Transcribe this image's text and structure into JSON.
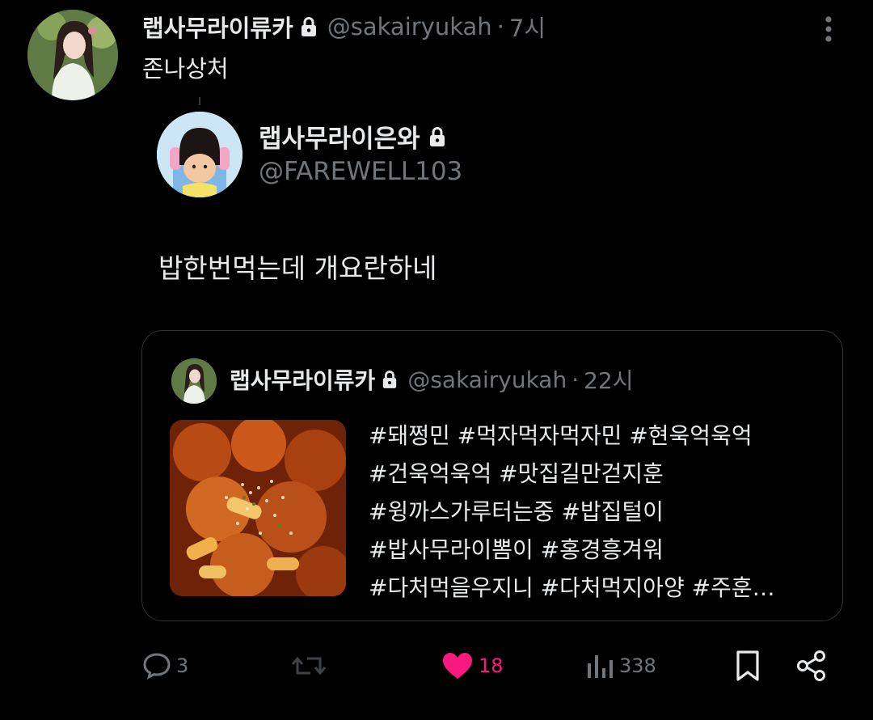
{
  "tweet": {
    "display_name": "랩사무라이류카",
    "handle": "@sakairyukah",
    "separator": "·",
    "time": "7시",
    "text": "존나상처"
  },
  "embedded": {
    "display_name": "랩사무라이은와",
    "handle": "@FAREWELL103",
    "text": "밥한번먹는데 개요란하네"
  },
  "quote": {
    "display_name": "랩사무라이류카",
    "handle": "@sakairyukah",
    "separator": "·",
    "time": "22시",
    "hashtags": [
      "#돼쩡민 #먹자먹자먹자민 #현욱억욱억",
      "#건욱억욱억 #맛집길만걷지훈",
      "#윙까스가루터는중  #밥집털이",
      "#밥사무라이뽐이 #홍경흥겨워",
      "#다처먹을우지니 #다처먹지아양 #주훈…"
    ]
  },
  "actions": {
    "replies": "3",
    "likes": "18",
    "views": "338"
  },
  "colors": {
    "background": "#000000",
    "text": "#e7e9ea",
    "muted": "#71767b",
    "like": "#f91880",
    "border": "#2f3336"
  },
  "icons": [
    "lock-icon",
    "more-icon",
    "reply-icon",
    "retweet-icon",
    "heart-icon",
    "views-icon",
    "bookmark-icon",
    "share-icon"
  ]
}
